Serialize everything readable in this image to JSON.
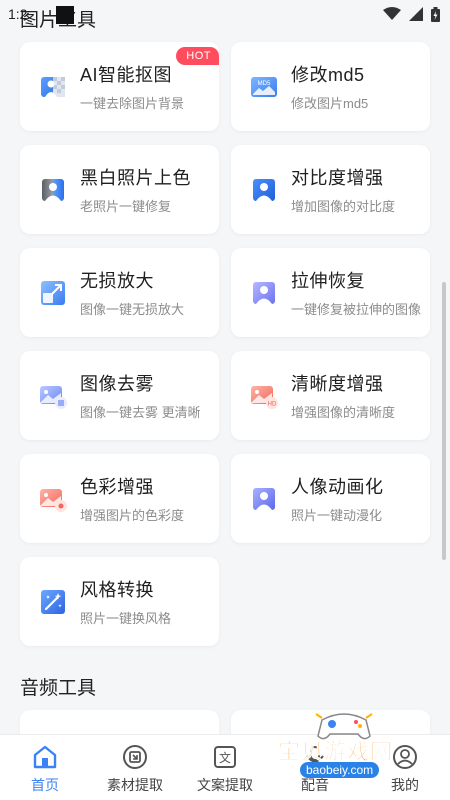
{
  "status": {
    "time": "1:2"
  },
  "header": {
    "title": "图片工具"
  },
  "image_tools": [
    {
      "title": "AI智能抠图",
      "subtitle": "一键去除图片背景",
      "badge": "HOT",
      "icon": "cutout-icon"
    },
    {
      "title": "修改md5",
      "subtitle": "修改图片md5",
      "icon": "md5-icon"
    },
    {
      "title": "黑白照片上色",
      "subtitle": "老照片一键修复",
      "icon": "colorize-icon"
    },
    {
      "title": "对比度增强",
      "subtitle": "增加图像的对比度",
      "icon": "contrast-icon"
    },
    {
      "title": "无损放大",
      "subtitle": "图像一键无损放大",
      "icon": "upscale-icon"
    },
    {
      "title": "拉伸恢复",
      "subtitle": "一键修复被拉伸的图像",
      "icon": "stretch-restore-icon"
    },
    {
      "title": "图像去雾",
      "subtitle": "图像一键去雾 更清晰",
      "icon": "dehaze-icon"
    },
    {
      "title": "清晰度增强",
      "subtitle": "增强图像的清晰度",
      "icon": "hd-enhance-icon"
    },
    {
      "title": "色彩增强",
      "subtitle": "增强图片的色彩度",
      "icon": "color-enhance-icon"
    },
    {
      "title": "人像动画化",
      "subtitle": "照片一键动漫化",
      "icon": "portrait-anime-icon"
    },
    {
      "title": "风格转换",
      "subtitle": "照片一键换风格",
      "icon": "style-transfer-icon"
    }
  ],
  "audio_section": {
    "title": "音频工具"
  },
  "bottom_nav": [
    {
      "label": "首页",
      "icon": "home-icon",
      "active": true
    },
    {
      "label": "素材提取",
      "icon": "material-extract-icon"
    },
    {
      "label": "文案提取",
      "icon": "text-extract-icon"
    },
    {
      "label": "配音",
      "icon": "dubbing-icon"
    },
    {
      "label": "我的",
      "icon": "profile-icon"
    }
  ],
  "watermark": {
    "title": "宝贝游戏网",
    "url": "baobeiy.com"
  },
  "colors": {
    "accent": "#3b82f6",
    "hot_badge": "#ff4d5e",
    "background": "#f5f6f8"
  }
}
